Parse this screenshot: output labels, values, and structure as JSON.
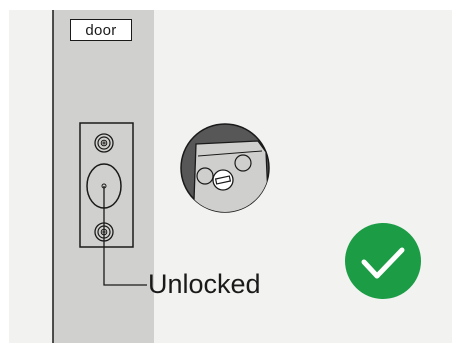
{
  "diagram": {
    "door_label": "door",
    "status_label": "Unlocked",
    "lock_state": "unlocked",
    "status_icon": "checkmark-icon",
    "colors": {
      "background": "#f2f2f0",
      "door_panel": "#d0d0ce",
      "outline": "#1a1a1a",
      "status_green": "#1b9c45",
      "check_mark": "#ffffff"
    }
  }
}
